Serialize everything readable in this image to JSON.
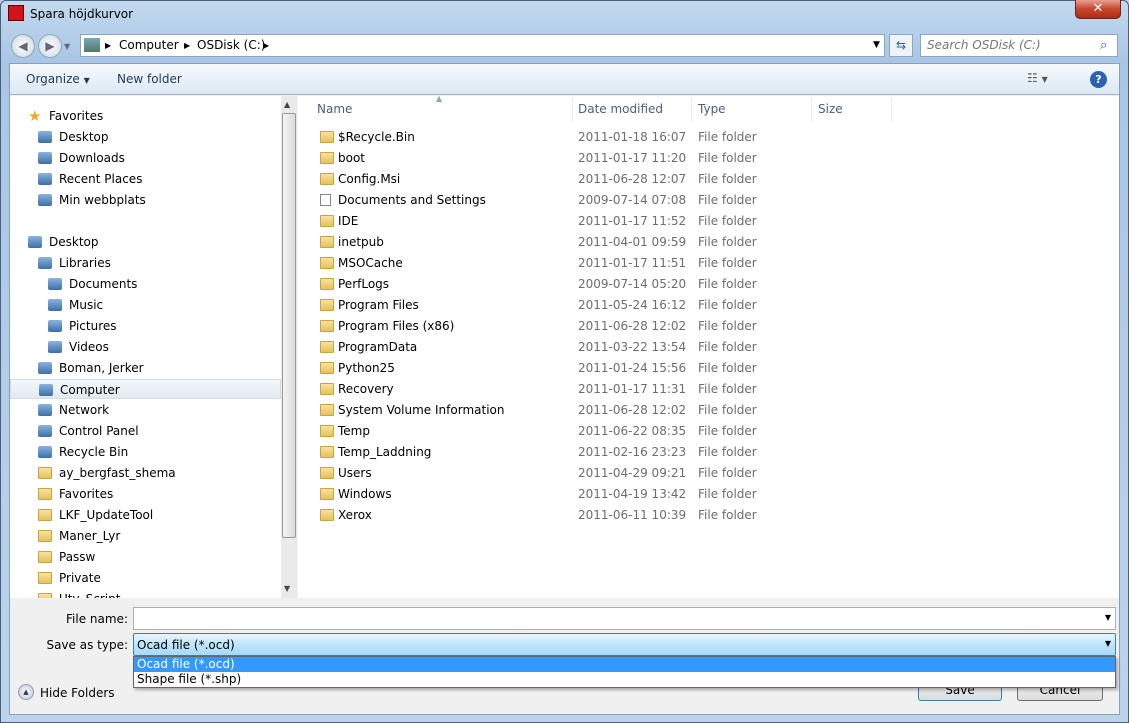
{
  "window": {
    "title": "Spara höjdkurvor",
    "close": "✕"
  },
  "address": {
    "crumbs": [
      "Computer",
      "OSDisk (C:)"
    ],
    "search_placeholder": "Search OSDisk (C:)"
  },
  "toolbar": {
    "organize": "Organize",
    "new_folder": "New folder"
  },
  "nav": [
    {
      "label": "Favorites",
      "level": 0,
      "icon": "star-icon"
    },
    {
      "label": "Desktop",
      "level": 1,
      "icon": "desktop-icon"
    },
    {
      "label": "Downloads",
      "level": 1,
      "icon": "downloads-icon"
    },
    {
      "label": "Recent Places",
      "level": 1,
      "icon": "recent-places-icon"
    },
    {
      "label": "Min webbplats",
      "level": 1,
      "icon": "website-icon"
    },
    {
      "label": "",
      "level": -1
    },
    {
      "label": "Desktop",
      "level": 0,
      "icon": "desktop-icon"
    },
    {
      "label": "Libraries",
      "level": 1,
      "icon": "libraries-icon"
    },
    {
      "label": "Documents",
      "level": 2,
      "icon": "documents-icon"
    },
    {
      "label": "Music",
      "level": 2,
      "icon": "music-icon"
    },
    {
      "label": "Pictures",
      "level": 2,
      "icon": "pictures-icon"
    },
    {
      "label": "Videos",
      "level": 2,
      "icon": "videos-icon"
    },
    {
      "label": "Boman, Jerker",
      "level": 1,
      "icon": "user-icon"
    },
    {
      "label": "Computer",
      "level": 1,
      "icon": "computer-icon",
      "selected": true
    },
    {
      "label": "Network",
      "level": 1,
      "icon": "network-icon"
    },
    {
      "label": "Control Panel",
      "level": 1,
      "icon": "control-panel-icon"
    },
    {
      "label": "Recycle Bin",
      "level": 1,
      "icon": "recycle-bin-icon"
    },
    {
      "label": "ay_bergfast_shema",
      "level": 1,
      "icon": "folder-icon"
    },
    {
      "label": "Favorites",
      "level": 1,
      "icon": "folder-icon"
    },
    {
      "label": "LKF_UpdateTool",
      "level": 1,
      "icon": "folder-icon"
    },
    {
      "label": "Maner_Lyr",
      "level": 1,
      "icon": "folder-icon"
    },
    {
      "label": "Passw",
      "level": 1,
      "icon": "folder-icon"
    },
    {
      "label": "Private",
      "level": 1,
      "icon": "folder-icon"
    },
    {
      "label": "Utv_Script",
      "level": 1,
      "icon": "folder-icon"
    }
  ],
  "columns": [
    "Name",
    "Date modified",
    "Type",
    "Size"
  ],
  "files": [
    {
      "name": "$Recycle.Bin",
      "date": "2011-01-18 16:07",
      "type": "File folder"
    },
    {
      "name": "boot",
      "date": "2011-01-17 11:20",
      "type": "File folder"
    },
    {
      "name": "Config.Msi",
      "date": "2011-06-28 12:07",
      "type": "File folder"
    },
    {
      "name": "Documents and Settings",
      "date": "2009-07-14 07:08",
      "type": "File folder",
      "shortcut": true
    },
    {
      "name": "IDE",
      "date": "2011-01-17 11:52",
      "type": "File folder"
    },
    {
      "name": "inetpub",
      "date": "2011-04-01 09:59",
      "type": "File folder"
    },
    {
      "name": "MSOCache",
      "date": "2011-01-17 11:51",
      "type": "File folder"
    },
    {
      "name": "PerfLogs",
      "date": "2009-07-14 05:20",
      "type": "File folder"
    },
    {
      "name": "Program Files",
      "date": "2011-05-24 16:12",
      "type": "File folder"
    },
    {
      "name": "Program Files (x86)",
      "date": "2011-06-28 12:02",
      "type": "File folder"
    },
    {
      "name": "ProgramData",
      "date": "2011-03-22 13:54",
      "type": "File folder"
    },
    {
      "name": "Python25",
      "date": "2011-01-24 15:56",
      "type": "File folder"
    },
    {
      "name": "Recovery",
      "date": "2011-01-17 11:31",
      "type": "File folder"
    },
    {
      "name": "System Volume Information",
      "date": "2011-06-28 12:02",
      "type": "File folder"
    },
    {
      "name": "Temp",
      "date": "2011-06-22 08:35",
      "type": "File folder"
    },
    {
      "name": "Temp_Laddning",
      "date": "2011-02-16 23:23",
      "type": "File folder"
    },
    {
      "name": "Users",
      "date": "2011-04-29 09:21",
      "type": "File folder"
    },
    {
      "name": "Windows",
      "date": "2011-04-19 13:42",
      "type": "File folder"
    },
    {
      "name": "Xerox",
      "date": "2011-06-11 10:39",
      "type": "File folder"
    }
  ],
  "form": {
    "file_name_label": "File name:",
    "file_name_value": "",
    "type_label": "Save as type:",
    "type_value": "Ocad file (*.ocd)",
    "type_options": [
      "Ocad file (*.ocd)",
      "Shape file (*.shp)"
    ],
    "selected_option": 0
  },
  "buttons": {
    "hide_folders": "Hide Folders",
    "save": "Save",
    "cancel": "Cancel"
  },
  "colors": {
    "selection": "#3399ff",
    "header_text": "#1e395b"
  }
}
